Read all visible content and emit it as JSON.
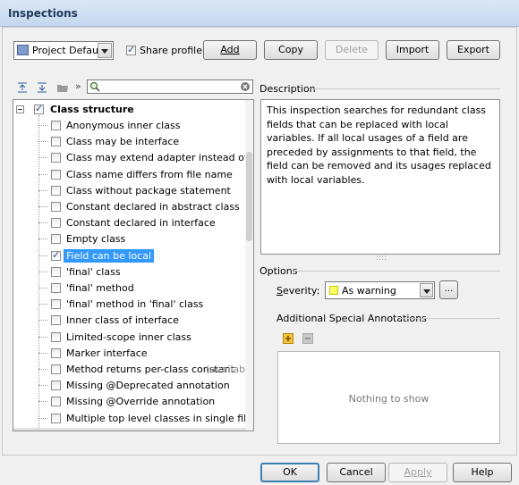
{
  "window": {
    "title": "Inspections"
  },
  "toolbar": {
    "profile": "Project Default",
    "share_profile": "Share profile",
    "share_profile_checked": true,
    "add": "Add",
    "copy": "Copy",
    "delete": "Delete",
    "import": "Import",
    "export": "Export"
  },
  "tree": {
    "group": "Class structure",
    "group_checked": true,
    "items": [
      {
        "label": "Anonymous inner class",
        "checked": false
      },
      {
        "label": "Class may be interface",
        "checked": false
      },
      {
        "label": "Class may extend adapter instead of impleme",
        "checked": false
      },
      {
        "label": "Class name differs from file name",
        "checked": false
      },
      {
        "label": "Class without package statement",
        "checked": false
      },
      {
        "label": "Constant declared in abstract class",
        "checked": false
      },
      {
        "label": "Constant declared in interface",
        "checked": false
      },
      {
        "label": "Empty class",
        "checked": false
      },
      {
        "label": "Field can be local",
        "checked": true,
        "selected": true
      },
      {
        "label": "'final' class",
        "checked": false
      },
      {
        "label": "'final' method",
        "checked": false
      },
      {
        "label": "'final' method in 'final' class",
        "checked": false
      },
      {
        "label": "Inner class of interface",
        "checked": false
      },
      {
        "label": "Limited-scope inner class",
        "checked": false
      },
      {
        "label": "Marker interface",
        "checked": false
      },
      {
        "label": "Method returns per-class constant",
        "suffix": "(available",
        "checked": false
      },
      {
        "label": "Missing @Deprecated annotation",
        "checked": false
      },
      {
        "label": "Missing @Override annotation",
        "checked": false
      },
      {
        "label": "Multiple top level classes in single file",
        "checked": false
      }
    ]
  },
  "description": {
    "heading": "Description",
    "text": "This inspection searches for redundant class fields that can be replaced with local variables. If all local usages of a field are preceded by assignments to that field, the field can be removed and its usages replaced with local variables."
  },
  "options": {
    "heading": "Options",
    "severity_label": "Severity:",
    "severity_value": "As warning",
    "severity_color": "#ffff66",
    "more_button": "...",
    "annotations_heading": "Additional Special Annotations",
    "empty_text": "Nothing to show"
  },
  "footer": {
    "ok": "OK",
    "cancel": "Cancel",
    "apply": "Apply",
    "help": "Help"
  }
}
